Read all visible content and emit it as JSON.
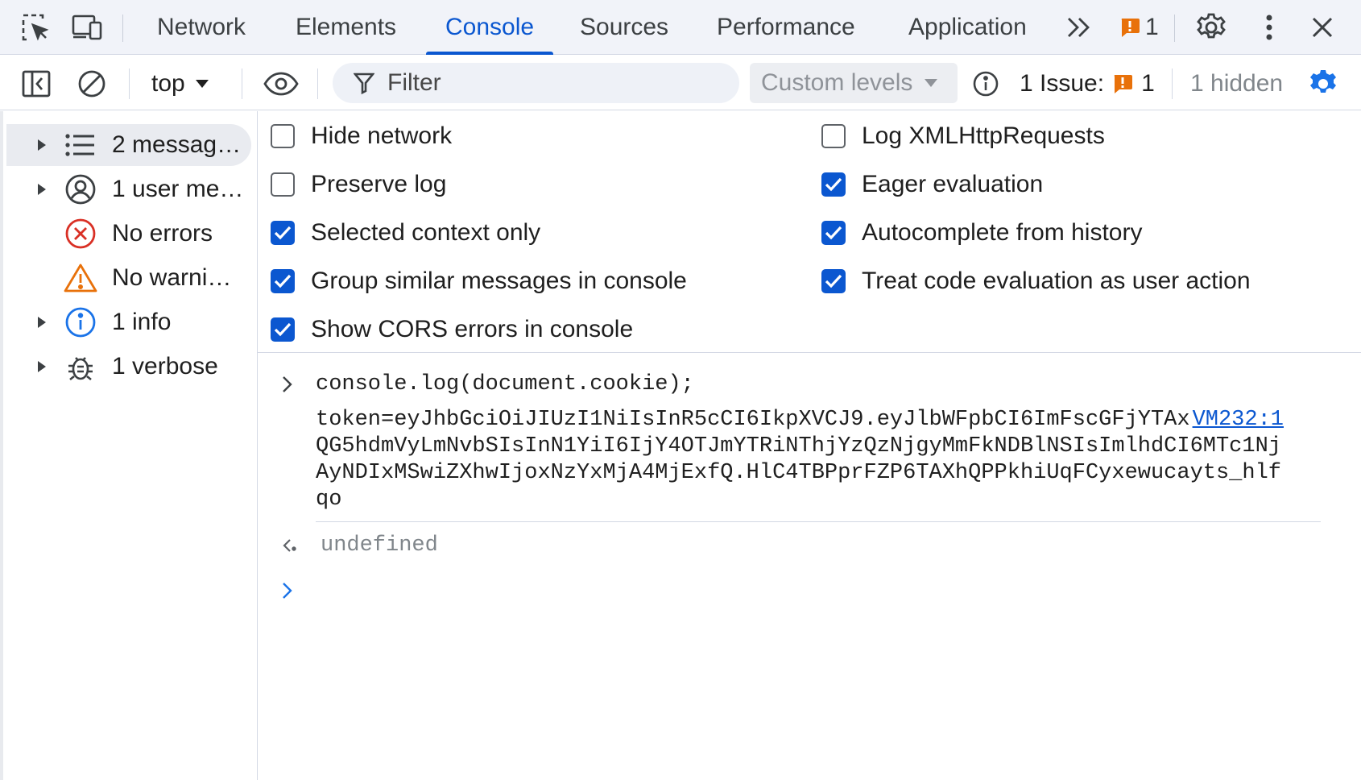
{
  "tabs": {
    "items": [
      {
        "label": "Network"
      },
      {
        "label": "Elements"
      },
      {
        "label": "Console",
        "active": true
      },
      {
        "label": "Sources"
      },
      {
        "label": "Performance"
      },
      {
        "label": "Application"
      }
    ],
    "issues_badge_count": "1",
    "icons": [
      "inspect-element-icon",
      "device-toolbar-icon",
      "more-tabs-icon",
      "issues-badge-icon",
      "settings-gear-icon",
      "kebab-menu-icon",
      "close-icon"
    ]
  },
  "toolbar": {
    "context": "top",
    "filter_placeholder": "Filter",
    "levels_label": "Custom levels",
    "issues_label": "1 Issue:",
    "issues_count": "1",
    "hidden_label": "1 hidden"
  },
  "sidebar": {
    "items": [
      {
        "label": "2 messag…",
        "icon": "list-icon",
        "expandable": true,
        "selected": true
      },
      {
        "label": "1 user me…",
        "icon": "user-icon",
        "expandable": true
      },
      {
        "label": "No errors",
        "icon": "error-icon",
        "expandable": false
      },
      {
        "label": "No warni…",
        "icon": "warning-icon",
        "expandable": false
      },
      {
        "label": "1 info",
        "icon": "info-icon",
        "expandable": true
      },
      {
        "label": "1 verbose",
        "icon": "bug-icon",
        "expandable": true
      }
    ]
  },
  "settings": {
    "left": [
      {
        "label": "Hide network",
        "checked": false
      },
      {
        "label": "Preserve log",
        "checked": false
      },
      {
        "label": "Selected context only",
        "checked": true
      },
      {
        "label": "Group similar messages in console",
        "checked": true
      },
      {
        "label": "Show CORS errors in console",
        "checked": true
      }
    ],
    "right": [
      {
        "label": "Log XMLHttpRequests",
        "checked": false
      },
      {
        "label": "Eager evaluation",
        "checked": true
      },
      {
        "label": "Autocomplete from history",
        "checked": true
      },
      {
        "label": "Treat code evaluation as user action",
        "checked": true
      }
    ]
  },
  "console": {
    "command": "console.log(document.cookie);",
    "output": "token=eyJhbGciOiJIUzI1NiIsInR5cCI6IkpXVCJ9.eyJlbWFpbCI6ImFscGFjYTAxQG5hdmVyLmNvbSIsInN1YiI6IjY4OTJmYTRiNThjYzQzNjgyMmFkNDBlNSIsImlhdCI6MTc1NjAyNDIxMSwiZXhwIjoxNzYxMjA4MjExfQ.HlC4TBPprFZP6TAXhQPPkhiUqFCyxewucayts_hlfqo",
    "source_link": "VM232:1",
    "return_value": "undefined"
  },
  "colors": {
    "accent": "#0b57d0",
    "error": "#d93025",
    "warning": "#e8710a",
    "issue_badge": "#e8710a"
  }
}
